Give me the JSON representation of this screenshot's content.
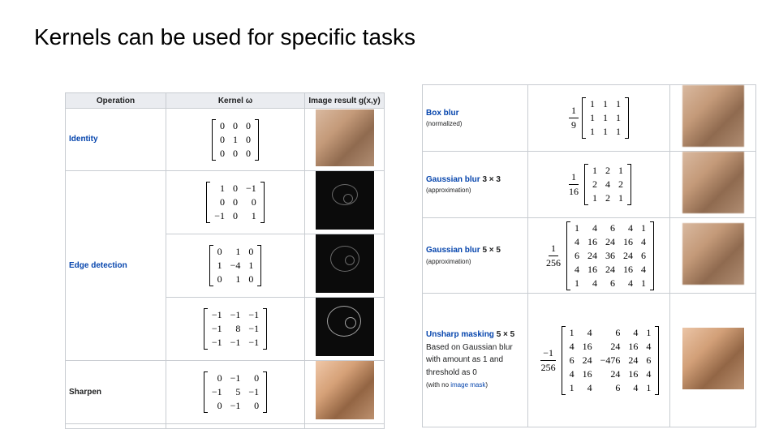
{
  "slide": {
    "title": "Kernels can be used for specific tasks"
  },
  "left_table": {
    "headers": [
      "Operation",
      "Kernel ω",
      "Image result g(x,y)"
    ],
    "identity": {
      "label": "Identity",
      "matrix": [
        [
          "0",
          "0",
          "0"
        ],
        [
          "0",
          "1",
          "0"
        ],
        [
          "0",
          "0",
          "0"
        ]
      ]
    },
    "edge": {
      "label": "Edge detection",
      "matrices": [
        [
          [
            "1",
            "0",
            "−1"
          ],
          [
            "0",
            "0",
            "0"
          ],
          [
            "−1",
            "0",
            "1"
          ]
        ],
        [
          [
            "0",
            "1",
            "0"
          ],
          [
            "1",
            "−4",
            "1"
          ],
          [
            "0",
            "1",
            "0"
          ]
        ],
        [
          [
            "−1",
            "−1",
            "−1"
          ],
          [
            "−1",
            "8",
            "−1"
          ],
          [
            "−1",
            "−1",
            "−1"
          ]
        ]
      ]
    },
    "sharpen": {
      "label": "Sharpen",
      "matrix": [
        [
          "0",
          "−1",
          "0"
        ],
        [
          "−1",
          "5",
          "−1"
        ],
        [
          "0",
          "−1",
          "0"
        ]
      ]
    }
  },
  "right_table": {
    "box": {
      "label": "Box blur",
      "note": "(normalized)",
      "num": "1",
      "den": "9",
      "matrix": [
        [
          "1",
          "1",
          "1"
        ],
        [
          "1",
          "1",
          "1"
        ],
        [
          "1",
          "1",
          "1"
        ]
      ]
    },
    "gauss3": {
      "label": "Gaussian blur",
      "size": "3 × 3",
      "note": "(approximation)",
      "num": "1",
      "den": "16",
      "matrix": [
        [
          "1",
          "2",
          "1"
        ],
        [
          "2",
          "4",
          "2"
        ],
        [
          "1",
          "2",
          "1"
        ]
      ]
    },
    "gauss5": {
      "label": "Gaussian blur",
      "size": "5 × 5",
      "note": "(approximation)",
      "num": "1",
      "den": "256",
      "matrix": [
        [
          "1",
          "4",
          "6",
          "4",
          "1"
        ],
        [
          "4",
          "16",
          "24",
          "16",
          "4"
        ],
        [
          "6",
          "24",
          "36",
          "24",
          "6"
        ],
        [
          "4",
          "16",
          "24",
          "16",
          "4"
        ],
        [
          "1",
          "4",
          "6",
          "4",
          "1"
        ]
      ]
    },
    "unsharp": {
      "label": "Unsharp masking",
      "size": "5 × 5",
      "desc": [
        "Based on Gaussian blur",
        "with amount as 1 and",
        "threshold as 0"
      ],
      "note_prefix": "(with no ",
      "note_link": "image mask",
      "note_suffix": ")",
      "num": "−1",
      "den": "256",
      "matrix": [
        [
          "1",
          "4",
          "6",
          "4",
          "1"
        ],
        [
          "4",
          "16",
          "24",
          "16",
          "4"
        ],
        [
          "6",
          "24",
          "−476",
          "24",
          "6"
        ],
        [
          "4",
          "16",
          "24",
          "16",
          "4"
        ],
        [
          "1",
          "4",
          "6",
          "4",
          "1"
        ]
      ]
    }
  },
  "icons": {
    "result_image": "squirrel-photo"
  }
}
